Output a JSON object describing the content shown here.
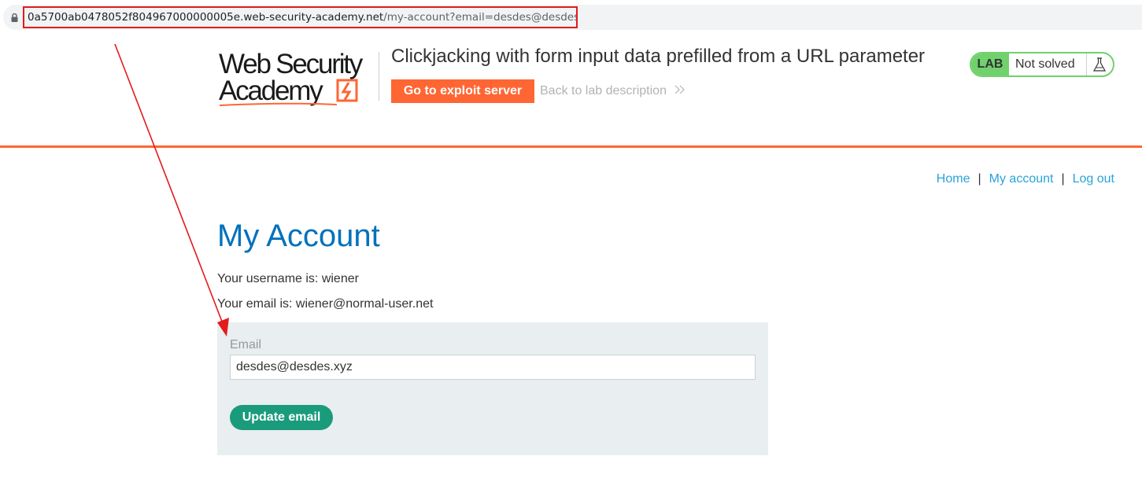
{
  "browser": {
    "url_host": "0a5700ab0478052f804967000000005e.web-security-academy.net",
    "url_path": "/my-account?email=desdes@desdes.xyz"
  },
  "header": {
    "logo_line1": "Web Security",
    "logo_line2": "Academy",
    "lab_title": "Clickjacking with form input data prefilled from a URL parameter",
    "exploit_button": "Go to exploit server",
    "back_link": "Back to lab description",
    "lab_badge": "LAB",
    "lab_state": "Not solved"
  },
  "nav": {
    "home": "Home",
    "my_account": "My account",
    "log_out": "Log out",
    "separator": "|"
  },
  "main": {
    "title": "My Account",
    "username_text": "Your username is: wiener",
    "email_text": "Your email is: wiener@normal-user.net",
    "form": {
      "email_label": "Email",
      "email_value": "desdes@desdes.xyz",
      "update_button": "Update email"
    }
  },
  "colors": {
    "accent_orange": "#ff6633",
    "lab_green": "#70d16d",
    "title_blue": "#0071bc",
    "button_teal": "#1a9b7c",
    "annotation_red": "#e31b1b"
  },
  "icons": [
    "lock-icon",
    "flask-icon",
    "chevron-right-icon",
    "logo-bolt-icon"
  ]
}
